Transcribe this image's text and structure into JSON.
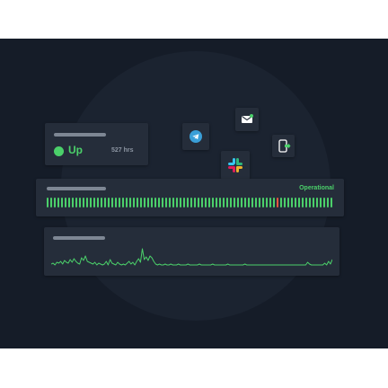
{
  "status": {
    "state": "Up",
    "uptime_hours": "527 hrs",
    "state_color": "#4bd06a"
  },
  "notification_channels": [
    {
      "icon": "telegram-icon",
      "color": "#3a9fd8"
    },
    {
      "icon": "email-icon",
      "color": "#ffffff"
    },
    {
      "icon": "sms-phone-icon",
      "color": "#4bd06a"
    },
    {
      "icon": "slack-icon",
      "color": "#e01e5a"
    }
  ],
  "uptime_bar": {
    "status_text": "Operational",
    "ok_color": "#4bd06a",
    "incident_color": "#e8553e",
    "checks": [
      1,
      1,
      1,
      1,
      1,
      1,
      1,
      1,
      1,
      1,
      1,
      1,
      1,
      1,
      1,
      1,
      1,
      1,
      1,
      1,
      1,
      1,
      1,
      1,
      1,
      1,
      1,
      1,
      1,
      1,
      1,
      1,
      1,
      1,
      1,
      1,
      1,
      1,
      1,
      1,
      1,
      1,
      1,
      1,
      1,
      1,
      1,
      1,
      1,
      1,
      1,
      1,
      1,
      1,
      1,
      1,
      1,
      1,
      1,
      1,
      1,
      1,
      1,
      1,
      0,
      1,
      1,
      1,
      1,
      1,
      1,
      1,
      1,
      1,
      1,
      1,
      1,
      1,
      1,
      1
    ]
  },
  "response_chart": {
    "line_color": "#4bd06a",
    "samples": [
      3,
      4,
      2,
      5,
      4,
      6,
      3,
      7,
      5,
      4,
      8,
      5,
      9,
      6,
      4,
      3,
      10,
      7,
      12,
      6,
      5,
      4,
      3,
      5,
      2,
      4,
      3,
      2,
      3,
      6,
      2,
      8,
      4,
      3,
      2,
      5,
      3,
      2,
      3,
      2,
      4,
      6,
      3,
      5,
      2,
      6,
      9,
      5,
      20,
      8,
      11,
      7,
      12,
      10,
      6,
      3,
      2,
      3,
      2,
      2,
      3,
      2,
      2,
      3,
      2,
      2,
      2,
      3,
      2,
      2,
      2,
      2,
      3,
      2,
      2,
      2,
      2,
      2,
      3,
      2,
      2,
      2,
      2,
      2,
      2,
      3,
      2,
      2,
      2,
      2,
      2,
      2,
      2,
      3,
      2,
      2,
      2,
      2,
      2,
      2,
      2,
      2,
      3,
      2,
      2,
      2,
      2,
      2,
      2,
      2,
      2,
      2,
      2,
      2,
      2,
      2,
      2,
      2,
      2,
      2,
      2,
      2,
      2,
      2,
      2,
      2,
      2,
      2,
      2,
      2,
      2,
      2,
      2,
      2,
      2,
      5,
      3,
      2,
      2,
      2,
      2,
      2,
      2,
      2,
      4,
      2,
      6,
      3,
      8
    ]
  }
}
